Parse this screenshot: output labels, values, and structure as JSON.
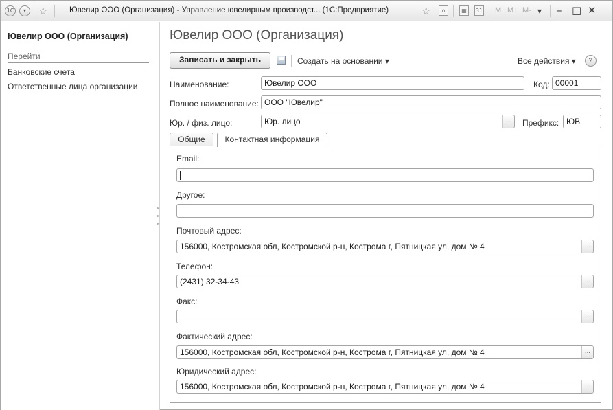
{
  "titlebar": {
    "logo_icon": "1c-logo-icon",
    "title": "Ювелир ООО (Организация) - Управление ювелирным производст... (1С:Предприятие)",
    "m_labels": [
      "M",
      "M+",
      "M-"
    ]
  },
  "leftpanel": {
    "title": "Ювелир ООО (Организация)",
    "section": "Перейти",
    "links": [
      "Банковские счета",
      "Ответственные лица организации"
    ]
  },
  "form": {
    "title": "Ювелир ООО (Организация)",
    "save_close_label": "Записать и закрыть",
    "create_based_label": "Создать на основании ▾",
    "all_actions_label": "Все действия ▾",
    "help_label": "?"
  },
  "fields": {
    "name_label": "Наименование:",
    "name_value": "Ювелир ООО",
    "code_label": "Код:",
    "code_value": "00001",
    "fullname_label": "Полное наименование:",
    "fullname_value": "ООО \"Ювелир\"",
    "entity_label": "Юр. / физ. лицо:",
    "entity_value": "Юр. лицо",
    "prefix_label": "Префикс:",
    "prefix_value": "ЮВ"
  },
  "tabs": [
    "Общие",
    "Контактная информация"
  ],
  "contact": {
    "email_label": "Email:",
    "email_value": "",
    "other_label": "Другое:",
    "other_value": "",
    "postal_label": "Почтовый адрес:",
    "postal_value": "156000, Костромская обл, Костромской р-н, Кострома г, Пятницкая ул, дом № 4",
    "phone_label": "Телефон:",
    "phone_value": "(2431) 32-34-43",
    "fax_label": "Факс:",
    "fax_value": "",
    "actual_label": "Фактический адрес:",
    "actual_value": "156000, Костромская обл, Костромской р-н, Кострома г, Пятницкая ул, дом № 4",
    "legal_label": "Юридический адрес:",
    "legal_value": "156000, Костромская обл, Костромской р-н, Кострома г, Пятницкая ул, дом № 4"
  },
  "select_button_label": "..."
}
